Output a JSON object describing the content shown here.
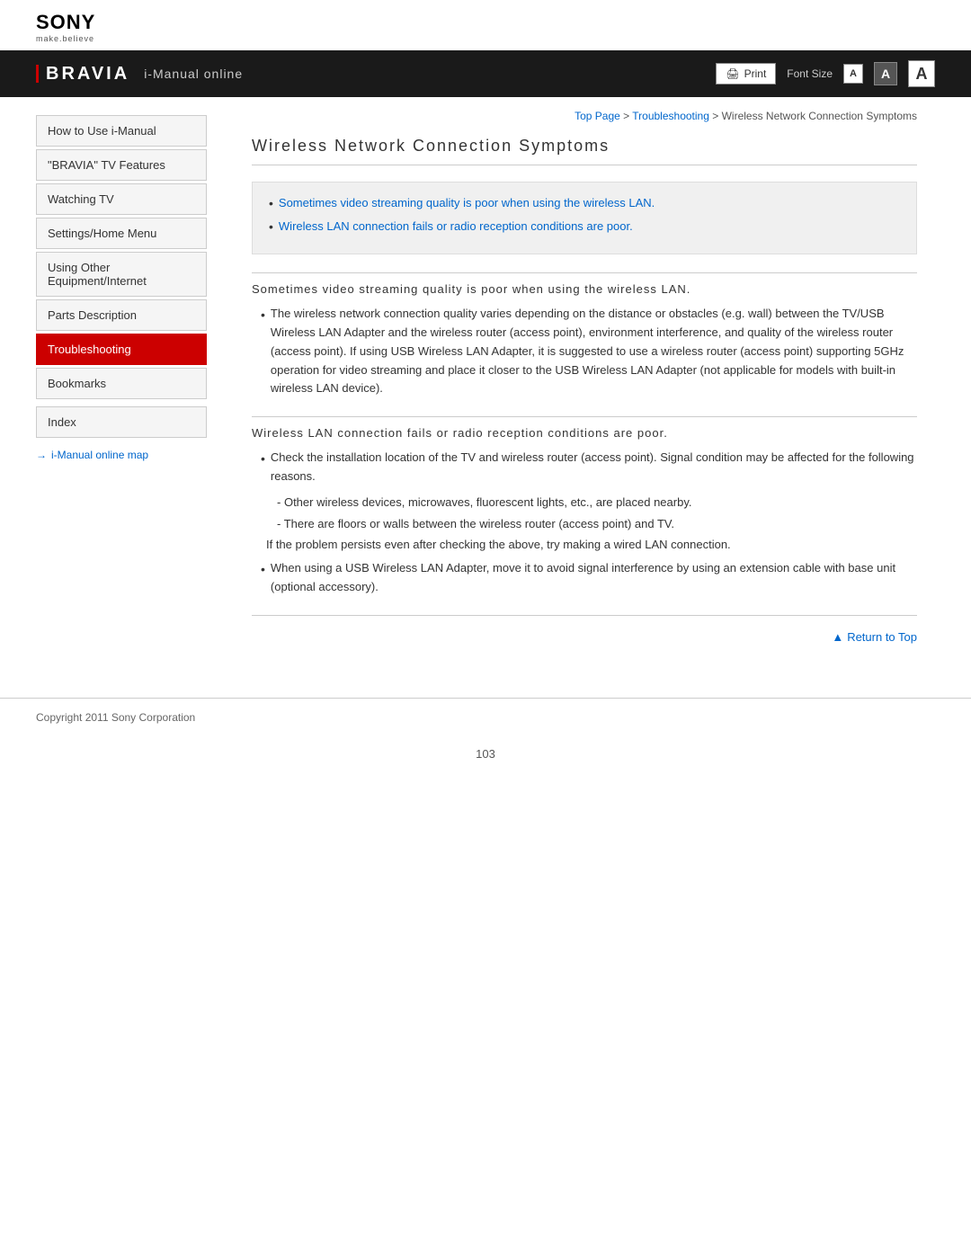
{
  "header": {
    "sony_logo": "SONY",
    "sony_tagline": "make.believe",
    "bravia_logo": "BRAVIA",
    "imanual_label": "i-Manual online",
    "print_button": "Print",
    "font_size_label": "Font Size",
    "font_small": "A",
    "font_medium": "A",
    "font_large": "A"
  },
  "breadcrumb": {
    "top_page": "Top Page",
    "separator1": " > ",
    "troubleshooting": "Troubleshooting",
    "separator2": " > ",
    "current": "Wireless Network Connection Symptoms"
  },
  "sidebar": {
    "items": [
      {
        "label": "How to Use i-Manual",
        "active": false
      },
      {
        "label": "\"BRAVIA\" TV Features",
        "active": false
      },
      {
        "label": "Watching TV",
        "active": false
      },
      {
        "label": "Settings/Home Menu",
        "active": false
      },
      {
        "label": "Using Other Equipment/Internet",
        "active": false
      },
      {
        "label": "Parts Description",
        "active": false
      },
      {
        "label": "Troubleshooting",
        "active": true
      },
      {
        "label": "Bookmarks",
        "active": false
      }
    ],
    "index": "Index",
    "map_link": "i-Manual online map"
  },
  "page": {
    "title": "Wireless Network Connection Symptoms",
    "summary_links": [
      "Sometimes video streaming quality is poor when using the wireless LAN.",
      "Wireless LAN connection fails or radio reception conditions are poor."
    ],
    "section1": {
      "heading": "Sometimes video streaming quality is poor when using the wireless LAN.",
      "bullet1": "The wireless network connection quality varies depending on the distance or obstacles (e.g. wall) between the TV/USB Wireless LAN Adapter and the wireless router (access point), environment interference, and quality of the wireless router (access point). If using USB Wireless LAN Adapter, it is suggested to use a wireless router (access point) supporting 5GHz operation for video streaming and place it closer to the USB Wireless LAN Adapter (not applicable for models with built-in wireless LAN device)."
    },
    "section2": {
      "heading": "Wireless LAN connection fails or radio reception conditions are poor.",
      "bullet1": "Check the installation location of the TV and wireless router (access point). Signal condition may be affected for the following reasons.",
      "dash1": "Other wireless devices, microwaves, fluorescent lights, etc., are placed nearby.",
      "dash2": "There are floors or walls between the wireless router (access point) and TV.",
      "note": "If the problem persists even after checking the above, try making a wired LAN connection.",
      "bullet2": "When using a USB Wireless LAN Adapter, move it to avoid signal interference by using an extension cable with base unit (optional accessory)."
    },
    "return_to_top": "Return to Top"
  },
  "footer": {
    "copyright": "Copyright 2011 Sony Corporation"
  },
  "page_number": "103"
}
